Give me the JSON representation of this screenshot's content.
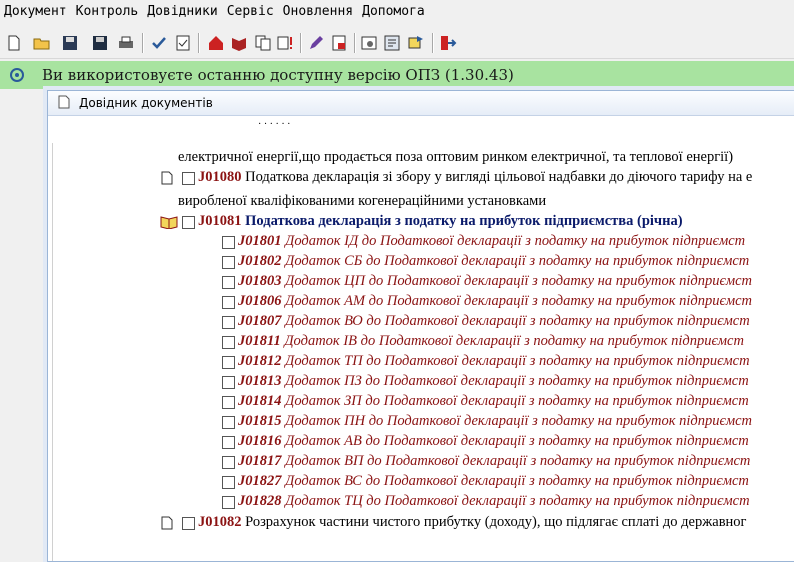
{
  "menu": [
    "Документ",
    "Контроль",
    "Довідники",
    "Сервіс",
    "Оновлення",
    "Допомога"
  ],
  "toolbar_icons": [
    "new-icon",
    "open-icon",
    "save-icon",
    "save-all-icon",
    "print-icon",
    "check-icon",
    "validate-icon",
    "home-icon",
    "book-icon",
    "copy-icon",
    "alert-icon",
    "pen-icon",
    "pdf-icon",
    "settings-icon",
    "report-icon",
    "export-icon",
    "exit-icon"
  ],
  "banner": {
    "text": "Ви використовуєте останню доступну версію ОПЗ (1.30.43)",
    "color": "#a8e3a0"
  },
  "window": {
    "title": "Довідник документів"
  },
  "tree": {
    "top_partial": "·  ·                          ·        ·        ·  ·",
    "lines": [
      {
        "text": "електричної енергії,що продається поза оптовим ринком електричної, та теплової енергії)"
      },
      {
        "code": "J01080",
        "text": "Податкова декларація зі збору у вигляді цільової надбавки до діючого тарифу на е"
      },
      {
        "text": "виробленої кваліфікованими когенераційними установками"
      },
      {
        "code": "J01081",
        "text": "Податкова декларація з податку на прибуток підприємства (річна)"
      }
    ],
    "children": [
      {
        "code": "J01801",
        "text": "Додаток ІД до Податкової декларації з податку на прибуток підприємст"
      },
      {
        "code": "J01802",
        "text": "Додаток СБ до Податкової декларації з податку на прибуток підприємст"
      },
      {
        "code": "J01803",
        "text": "Додаток ЦП до Податкової декларації з податку на прибуток підприємст"
      },
      {
        "code": "J01806",
        "text": "Додаток АМ до Податкової декларації з податку на прибуток підприємст"
      },
      {
        "code": "J01807",
        "text": "Додаток ВО до Податкової декларації з податку на прибуток підприємст"
      },
      {
        "code": "J01811",
        "text": "Додаток ІВ до Податкової декларації з податку на прибуток підприємст"
      },
      {
        "code": "J01812",
        "text": "Додаток ТП до Податкової декларації з податку на прибуток підприємст"
      },
      {
        "code": "J01813",
        "text": "Додаток ПЗ до Податкової декларації з податку на прибуток підприємст"
      },
      {
        "code": "J01814",
        "text": "Додаток ЗП до Податкової декларації з податку на прибуток підприємст"
      },
      {
        "code": "J01815",
        "text": "Додаток ПН до Податкової декларації з податку на прибуток підприємст"
      },
      {
        "code": "J01816",
        "text": "Додаток АВ до Податкової декларації з податку на прибуток підприємст"
      },
      {
        "code": "J01817",
        "text": "Додаток ВП до Податкової декларації з податку на прибуток підприємст"
      },
      {
        "code": "J01827",
        "text": "Додаток ВС до Податкової декларації з податку на прибуток підприємст"
      },
      {
        "code": "J01828",
        "text": "Додаток ТЦ до Податкової декларації з податку на прибуток підприємст"
      }
    ],
    "last": {
      "code": "J01082",
      "text": "Розрахунок частини чистого прибутку (доходу), що підлягає сплаті до державног"
    }
  }
}
